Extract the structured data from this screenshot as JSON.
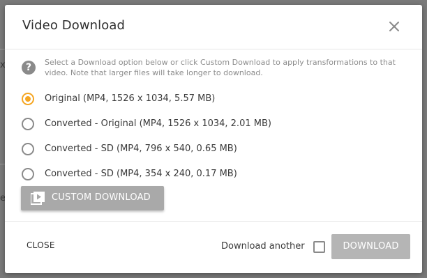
{
  "dialog": {
    "title": "Video Download",
    "close_icon": "close-icon"
  },
  "help": {
    "icon": "help-icon",
    "glyph": "?",
    "text": "Select a Download option below or click Custom Download to apply transformations to that video. Note that larger files will take longer to download."
  },
  "options": [
    {
      "label": "Original (MP4, 1526 x 1034, 5.57 MB)",
      "selected": true
    },
    {
      "label": "Converted - Original (MP4, 1526 x 1034, 2.01 MB)",
      "selected": false
    },
    {
      "label": "Converted - SD (MP4, 796 x 540, 0.65 MB)",
      "selected": false
    },
    {
      "label": "Converted - SD (MP4, 354 x 240, 0.17 MB)",
      "selected": false
    }
  ],
  "custom_download": {
    "label": "CUSTOM DOWNLOAD",
    "icon": "play-icon"
  },
  "footer": {
    "close_label": "CLOSE",
    "download_another_label": "Download another",
    "download_another_checked": false,
    "download_label": "DOWNLOAD"
  },
  "colors": {
    "accent": "#f5a623",
    "disabled_button": "#b5b5b5",
    "custom_button": "#a9a9a9"
  },
  "background": {
    "glyph_top": "x",
    "glyph_bottom": "e"
  }
}
